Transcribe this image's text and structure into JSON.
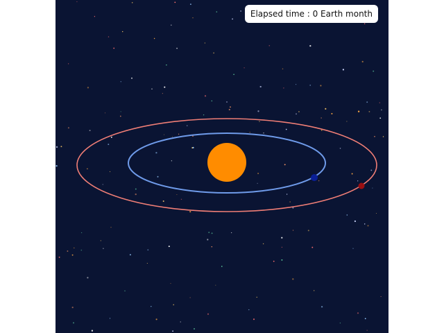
{
  "elapsed": {
    "label": "Elapsed time : 0 Earth month"
  },
  "colors": {
    "space_background": "#0a1433",
    "sun": "#ff8c00",
    "earth_orbit": "#6f9bea",
    "earth": "#0a1f96",
    "mars_orbit": "#f07e76",
    "mars": "#9a0f12"
  },
  "bodies": [
    {
      "name": "sun",
      "icon": "sun-icon"
    },
    {
      "name": "earth",
      "icon": "planet-earth-icon"
    },
    {
      "name": "mars",
      "icon": "planet-mars-icon"
    }
  ]
}
